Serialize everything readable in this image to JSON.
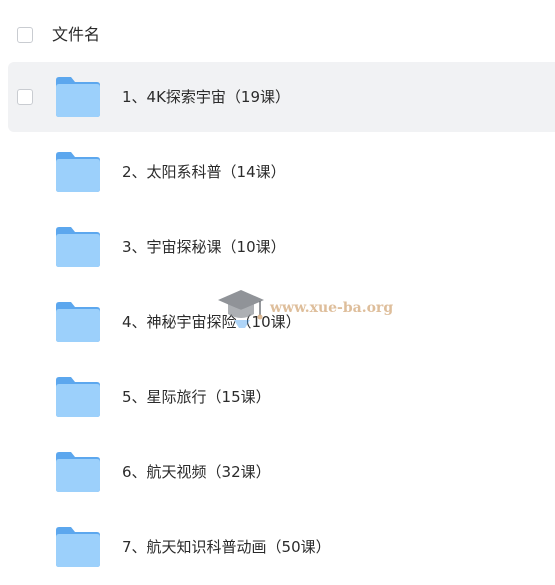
{
  "header": {
    "label": "文件名"
  },
  "files": [
    {
      "name": "1、4K探索宇宙（19课）",
      "selected": true
    },
    {
      "name": "2、太阳系科普（14课）",
      "selected": false
    },
    {
      "name": "3、宇宙探秘课（10课）",
      "selected": false
    },
    {
      "name": "4、神秘宇宙探险（10课）",
      "selected": false
    },
    {
      "name": "5、星际旅行（15课）",
      "selected": false
    },
    {
      "name": "6、航天视频（32课）",
      "selected": false
    },
    {
      "name": "7、航天知识科普动画（50课）",
      "selected": false
    }
  ],
  "watermark": {
    "text": "www.xue-ba.org"
  },
  "colors": {
    "folder_light": "#9cd0fb",
    "folder_dark": "#5ca7ee",
    "selected_bg": "#f1f2f4",
    "watermark": "#d9b38a"
  },
  "icons": {
    "folder": "folder-icon",
    "watermark": "graduation-cap-icon"
  }
}
